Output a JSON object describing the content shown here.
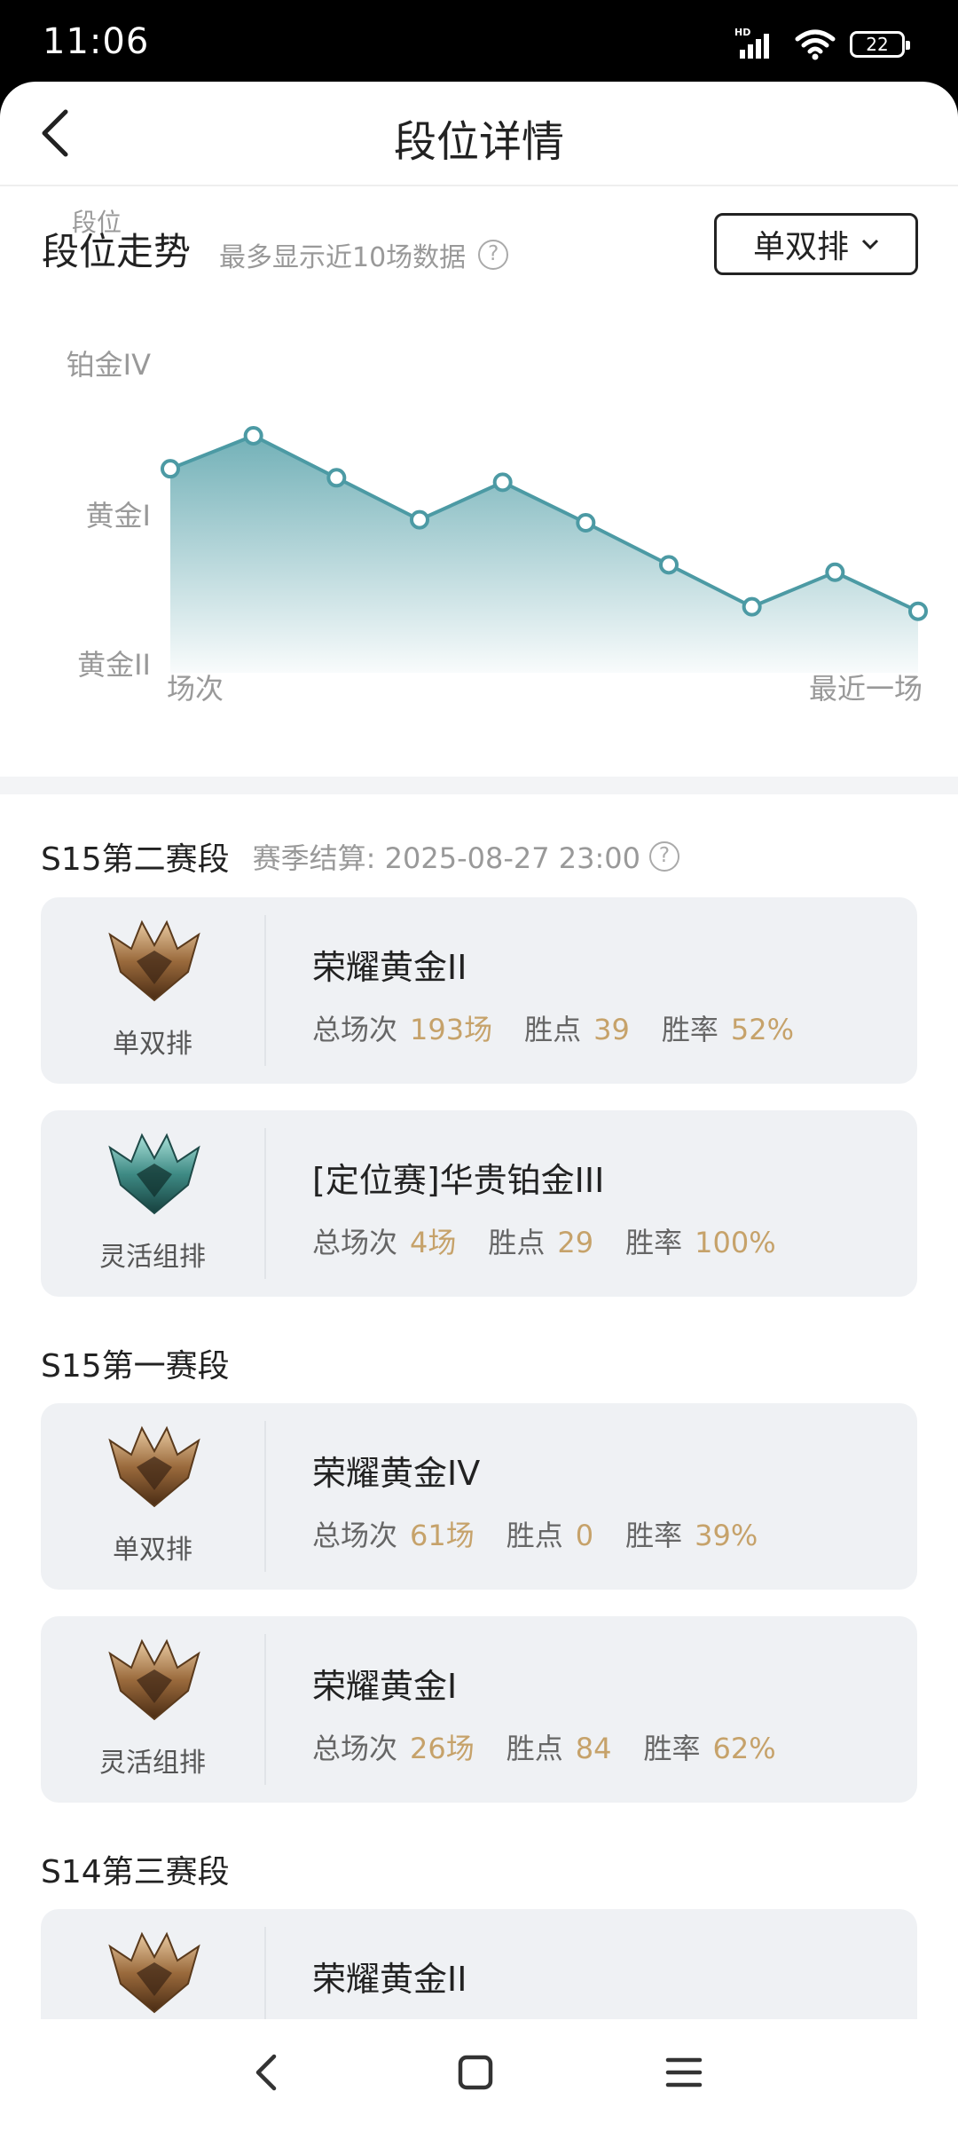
{
  "status_bar": {
    "time": "11:06",
    "network_label": "HD",
    "battery": "22"
  },
  "header": {
    "title": "段位详情"
  },
  "trend": {
    "title": "段位走势",
    "hint": "最多显示近10场数据",
    "mode": "单双排"
  },
  "chart_data": {
    "type": "area",
    "ylabel": "段位",
    "xlabel_start": "场次",
    "xlabel_end": "最近一场",
    "y_tick_labels": [
      "铂金IV",
      "黄金I",
      "黄金II"
    ],
    "y_tick_values": [
      2,
      1,
      0
    ],
    "ylim": [
      0,
      2
    ],
    "grid": false,
    "series": [
      {
        "values": [
          1.36,
          1.58,
          1.3,
          1.02,
          1.27,
          1.0,
          0.72,
          0.44,
          0.67,
          0.41
        ]
      }
    ],
    "line_color": "#4c9aa4"
  },
  "seasons": [
    {
      "title": "S15第二赛段",
      "settle_label": "赛季结算: 2025-08-27 23:00",
      "cards": [
        {
          "queue": "单双排",
          "rank": "荣耀黄金II",
          "games_label": "总场次",
          "games": "193场",
          "points_label": "胜点",
          "points": "39",
          "winrate_label": "胜率",
          "winrate": "52%",
          "emblem": "gold-emblem-icon"
        },
        {
          "queue": "灵活组排",
          "rank": "[定位赛]华贵铂金III",
          "games_label": "总场次",
          "games": "4场",
          "points_label": "胜点",
          "points": "29",
          "winrate_label": "胜率",
          "winrate": "100%",
          "emblem": "platinum-emblem-icon"
        }
      ]
    },
    {
      "title": "S15第一赛段",
      "cards": [
        {
          "queue": "单双排",
          "rank": "荣耀黄金IV",
          "games_label": "总场次",
          "games": "61场",
          "points_label": "胜点",
          "points": "0",
          "winrate_label": "胜率",
          "winrate": "39%",
          "emblem": "gold-emblem-icon"
        },
        {
          "queue": "灵活组排",
          "rank": "荣耀黄金I",
          "games_label": "总场次",
          "games": "26场",
          "points_label": "胜点",
          "points": "84",
          "winrate_label": "胜率",
          "winrate": "62%",
          "emblem": "gold-emblem-icon"
        }
      ]
    },
    {
      "title": "S14第三赛段",
      "cards": [
        {
          "rank": "荣耀黄金II",
          "emblem": "gold-emblem-icon"
        }
      ]
    }
  ],
  "colors": {
    "accent_value": "#c6a26a",
    "chart_line": "#4c9aa4",
    "card_bg": "#eff1f4"
  }
}
